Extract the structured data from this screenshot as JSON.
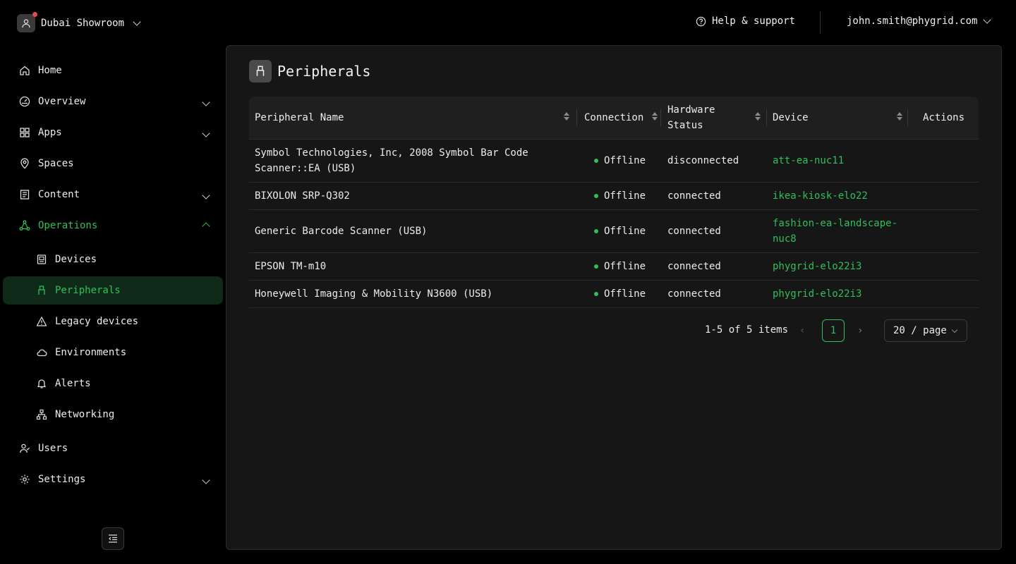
{
  "org": {
    "name": "Dubai Showroom",
    "icon": "user-icon"
  },
  "header": {
    "help_label": "Help & support",
    "user_email": "john.smith@phygrid.com"
  },
  "sidebar": {
    "items": [
      {
        "label": "Home",
        "icon": "home-icon"
      },
      {
        "label": "Overview",
        "icon": "gauge-icon"
      },
      {
        "label": "Apps",
        "icon": "grid-icon"
      },
      {
        "label": "Spaces",
        "icon": "map-pin-icon"
      },
      {
        "label": "Content",
        "icon": "document-icon"
      },
      {
        "label": "Operations",
        "icon": "operations-icon"
      },
      {
        "label": "Devices",
        "icon": "device-icon"
      },
      {
        "label": "Peripherals",
        "icon": "usb-icon"
      },
      {
        "label": "Legacy devices",
        "icon": "warning-icon"
      },
      {
        "label": "Environments",
        "icon": "cloud-icon"
      },
      {
        "label": "Alerts",
        "icon": "bell-icon"
      },
      {
        "label": "Networking",
        "icon": "network-icon"
      },
      {
        "label": "Users",
        "icon": "users-icon"
      },
      {
        "label": "Settings",
        "icon": "gear-icon"
      }
    ]
  },
  "page": {
    "title": "Peripherals",
    "icon": "usb-icon"
  },
  "table": {
    "columns": [
      "Peripheral Name",
      "Connection",
      "Hardware Status",
      "Device",
      "Actions"
    ],
    "rows": [
      {
        "name": "Symbol Technologies, Inc, 2008 Symbol Bar Code Scanner::EA (USB)",
        "connection": "Offline",
        "status": "disconnected",
        "device": "att-ea-nuc11"
      },
      {
        "name": "BIXOLON SRP-Q302",
        "connection": "Offline",
        "status": "connected",
        "device": "ikea-kiosk-elo22"
      },
      {
        "name": "Generic Barcode Scanner (USB)",
        "connection": "Offline",
        "status": "connected",
        "device": "fashion-ea-landscape-nuc8"
      },
      {
        "name": "EPSON TM-m10",
        "connection": "Offline",
        "status": "connected",
        "device": "phygrid-elo22i3"
      },
      {
        "name": "Honeywell Imaging & Mobility N3600 (USB)",
        "connection": "Offline",
        "status": "connected",
        "device": "phygrid-elo22i3"
      }
    ]
  },
  "pagination": {
    "total": "1-5 of 5 items",
    "current_page": "1",
    "page_size": "20 / page"
  },
  "colors": {
    "accent": "#2fbf5a",
    "background": "#000000",
    "panel": "#161616"
  }
}
